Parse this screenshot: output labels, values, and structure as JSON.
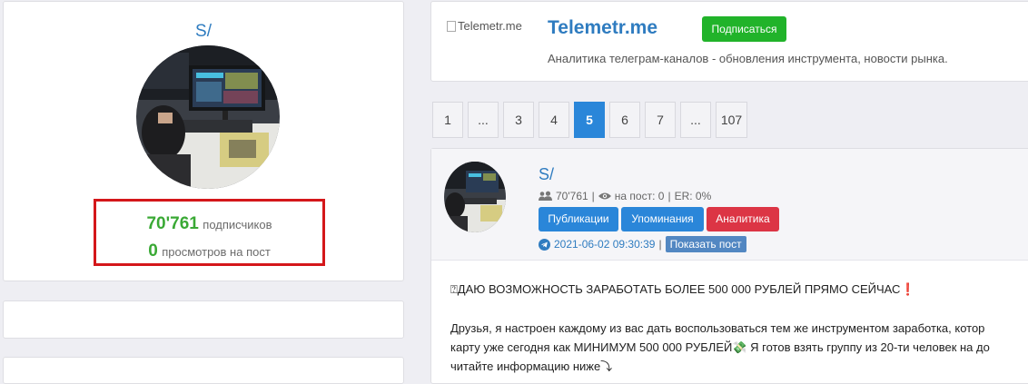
{
  "profile": {
    "name": "S/",
    "subscribers_value": "70'761",
    "subscribers_label": "подписчиков",
    "views_value": "0",
    "views_label": "просмотров на пост"
  },
  "channel_card": {
    "logo_alt": "Telemetr.me",
    "title": "Telemetr.me",
    "subscribe_label": "Подписаться",
    "description": "Аналитика телеграм-каналов - обновления инструмента, новости рынка."
  },
  "pagination": [
    "1",
    "...",
    "3",
    "4",
    "5",
    "6",
    "7",
    "...",
    "107"
  ],
  "pagination_active": "5",
  "post": {
    "author": "S/",
    "subscribers": "70'761",
    "sep1": "|",
    "views_label": "на пост: 0",
    "sep2": "|",
    "er": "ER: 0%",
    "buttons": {
      "publications": "Публикации",
      "mentions": "Упоминания",
      "analytics": "Аналитика"
    },
    "date": "2021-06-02 09:30:39",
    "date_sep": "|",
    "show_post": "Показать пост",
    "headline": "⍰ДАЮ ВОЗМОЖНОСТЬ ЗАРАБОТАТЬ БОЛЕЕ 500 000 РУБЛЕЙ ПРЯМО СЕЙЧАС❗",
    "line1": "Друзья, я настроен каждому из вас дать воспользоваться тем же инструментом заработка, котор",
    "line2": "карту уже сегодня как МИНИМУМ 500 000 РУБЛЕЙ💸 Я готов взять группу из 20-ти человек на до",
    "line3": "читайте информацию ниже⤵"
  },
  "colors": {
    "link_blue": "#2f7cc0",
    "green": "#21b32a",
    "stat_green": "#3aa935",
    "highlight_red": "#d4171a",
    "btn_blue": "#2a86d9",
    "btn_red": "#dc3545"
  }
}
